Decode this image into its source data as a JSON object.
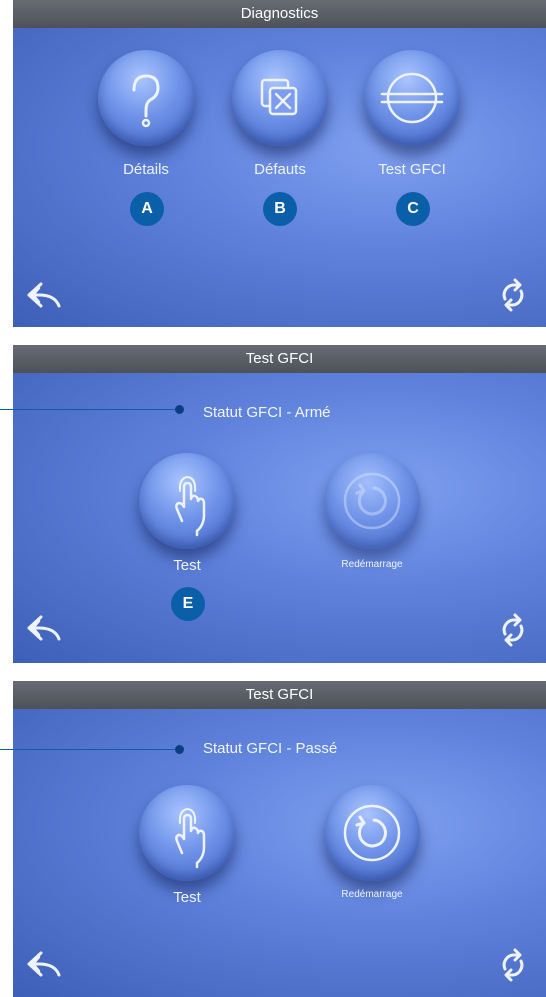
{
  "screens": [
    {
      "title": "Diagnostics",
      "buttons": [
        {
          "label": "Détails",
          "badge": "A",
          "icon": "question-mark-icon"
        },
        {
          "label": "Défauts",
          "badge": "B",
          "icon": "faults-icon"
        },
        {
          "label": "Test GFCI",
          "badge": "C",
          "icon": "gfci-test-icon"
        }
      ],
      "nav": {
        "back_icon": "back-arrow-icon",
        "refresh_icon": "refresh-icon"
      }
    },
    {
      "title": "Test GFCI",
      "status": "Statut GFCI - Armé",
      "test_label": "Test",
      "test_badge": "E",
      "restart_label": "Redémarrage"
    },
    {
      "title": "Test GFCI",
      "status": "Statut GFCI - Passé",
      "test_label": "Test",
      "restart_label": "Redémarrage"
    }
  ],
  "colors": {
    "badge": "#0b5ea8",
    "title_bar": "#5a5e66",
    "panel": "#5f82dc"
  }
}
